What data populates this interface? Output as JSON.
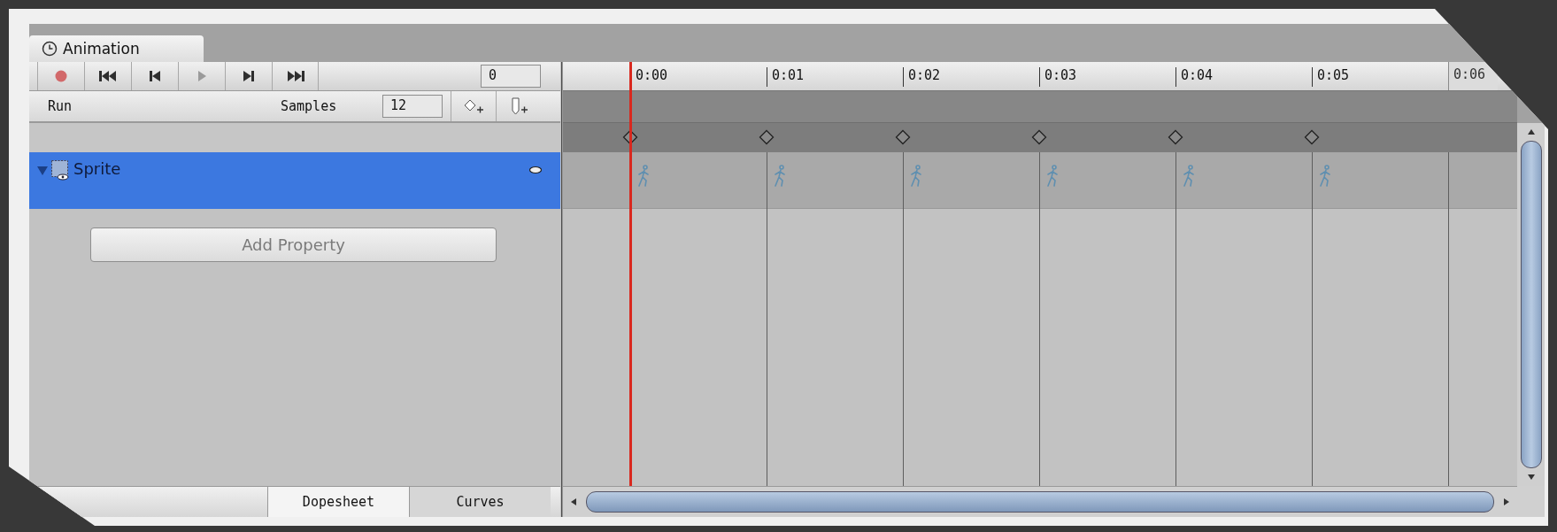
{
  "window": {
    "tab": "Animation"
  },
  "toolbar": {
    "buttons": [
      {
        "kind": "record",
        "disabled": false
      },
      {
        "kind": "first",
        "disabled": false
      },
      {
        "kind": "prev",
        "disabled": false
      },
      {
        "kind": "play",
        "disabled": true
      },
      {
        "kind": "next",
        "disabled": false
      },
      {
        "kind": "last",
        "disabled": false
      }
    ],
    "frame": "0"
  },
  "clip": {
    "name": "Run",
    "samples_label": "Samples",
    "samples": "12"
  },
  "tracks": [
    {
      "name": "Sprite",
      "selected": true,
      "expanded": true
    }
  ],
  "add_property": "Add Property",
  "timeline": {
    "ticks": [
      {
        "label": "0:00",
        "keyframe": true,
        "current": true
      },
      {
        "label": "0:01",
        "keyframe": true,
        "current": false
      },
      {
        "label": "0:02",
        "keyframe": true,
        "current": false
      },
      {
        "label": "0:03",
        "keyframe": true,
        "current": false
      },
      {
        "label": "0:04",
        "keyframe": true,
        "current": false
      },
      {
        "label": "0:05",
        "keyframe": true,
        "current": false
      },
      {
        "label": "0:06",
        "keyframe": false,
        "current": false
      }
    ]
  },
  "view_tabs": [
    {
      "label": "Dopesheet",
      "selected": true
    },
    {
      "label": "Curves",
      "selected": false
    }
  ]
}
